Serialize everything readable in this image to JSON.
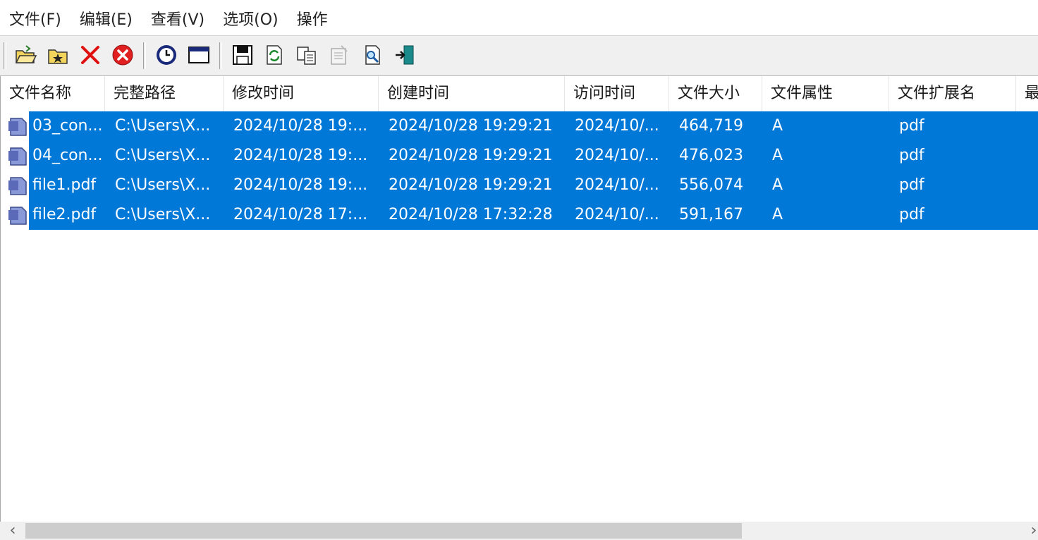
{
  "menu": [
    "文件(F)",
    "编辑(E)",
    "查看(V)",
    "选项(O)",
    "操作"
  ],
  "toolbar": {
    "buttons": [
      {
        "name": "open-folder-icon"
      },
      {
        "name": "add-folder-icon"
      },
      {
        "name": "delete-icon"
      },
      {
        "name": "stop-icon"
      },
      {
        "name": "clock-icon"
      },
      {
        "name": "window-icon"
      },
      {
        "name": "save-icon"
      },
      {
        "name": "refresh-icon"
      },
      {
        "name": "copy-icon"
      },
      {
        "name": "properties-icon"
      },
      {
        "name": "find-icon"
      },
      {
        "name": "exit-icon"
      }
    ]
  },
  "columns": [
    "文件名称",
    "完整路径",
    "修改时间",
    "创建时间",
    "访问时间",
    "文件大小",
    "文件属性",
    "文件扩展名",
    "最"
  ],
  "rows": [
    [
      "03_con...",
      "C:\\Users\\X...",
      "2024/10/28 19:...",
      "2024/10/28 19:29:21",
      "2024/10/...",
      "464,719",
      "A",
      "pdf"
    ],
    [
      "04_con...",
      "C:\\Users\\X...",
      "2024/10/28 19:...",
      "2024/10/28 19:29:21",
      "2024/10/...",
      "476,023",
      "A",
      "pdf"
    ],
    [
      "file1.pdf",
      "C:\\Users\\X...",
      "2024/10/28 19:...",
      "2024/10/28 19:29:21",
      "2024/10/...",
      "556,074",
      "A",
      "pdf"
    ],
    [
      "file2.pdf",
      "C:\\Users\\X...",
      "2024/10/28 17:...",
      "2024/10/28 17:32:28",
      "2024/10/...",
      "591,167",
      "A",
      "pdf"
    ]
  ],
  "scrollbar": {
    "left_arrow": "‹",
    "right_arrow": "›"
  },
  "colors": {
    "selection": "#0078d7",
    "toolbar_bg": "#f0f0f0"
  }
}
